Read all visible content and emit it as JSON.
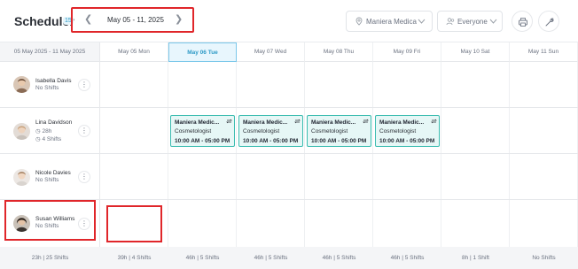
{
  "header": {
    "title": "Scheduler",
    "badge": "15",
    "date_range": "May 05 - 11, 2025",
    "location_filter": "Maniera Medica",
    "people_filter": "Everyone"
  },
  "grid": {
    "range_label": "05 May 2025 - 11 May 2025",
    "days": [
      {
        "label": "May 05 Mon",
        "today": false
      },
      {
        "label": "May 06 Tue",
        "today": true
      },
      {
        "label": "May 07 Wed",
        "today": false
      },
      {
        "label": "May 08 Thu",
        "today": false
      },
      {
        "label": "May 09 Fri",
        "today": false
      },
      {
        "label": "May 10 Sat",
        "today": false
      },
      {
        "label": "May 11 Sun",
        "today": false
      }
    ]
  },
  "employees": [
    {
      "name": "Isabella Davis",
      "line1": "No Shifts",
      "line2": null
    },
    {
      "name": "Lina Davidson",
      "line1": "28h",
      "line2": "4 Shifts"
    },
    {
      "name": "Nicole Davies",
      "line1": "No Shifts",
      "line2": null
    },
    {
      "name": "Susan Williams",
      "line1": "No Shifts",
      "line2": null
    }
  ],
  "shift": {
    "title": "Maniera Medic...",
    "role": "Cosmetologist",
    "time": "10:00 AM - 05:00 PM"
  },
  "footer": {
    "total": "23h | 25 Shifts",
    "days": [
      "39h | 4 Shifts",
      "46h | 5 Shifts",
      "46h | 5 Shifts",
      "46h | 5 Shifts",
      "46h | 5 Shifts",
      "8h | 1 Shift",
      "No Shifts"
    ]
  },
  "colors": {
    "accent": "#2e9ac6",
    "shift_border": "#3bbcb0",
    "shift_bg": "#e6f7f6",
    "highlight": "#e0262a"
  }
}
